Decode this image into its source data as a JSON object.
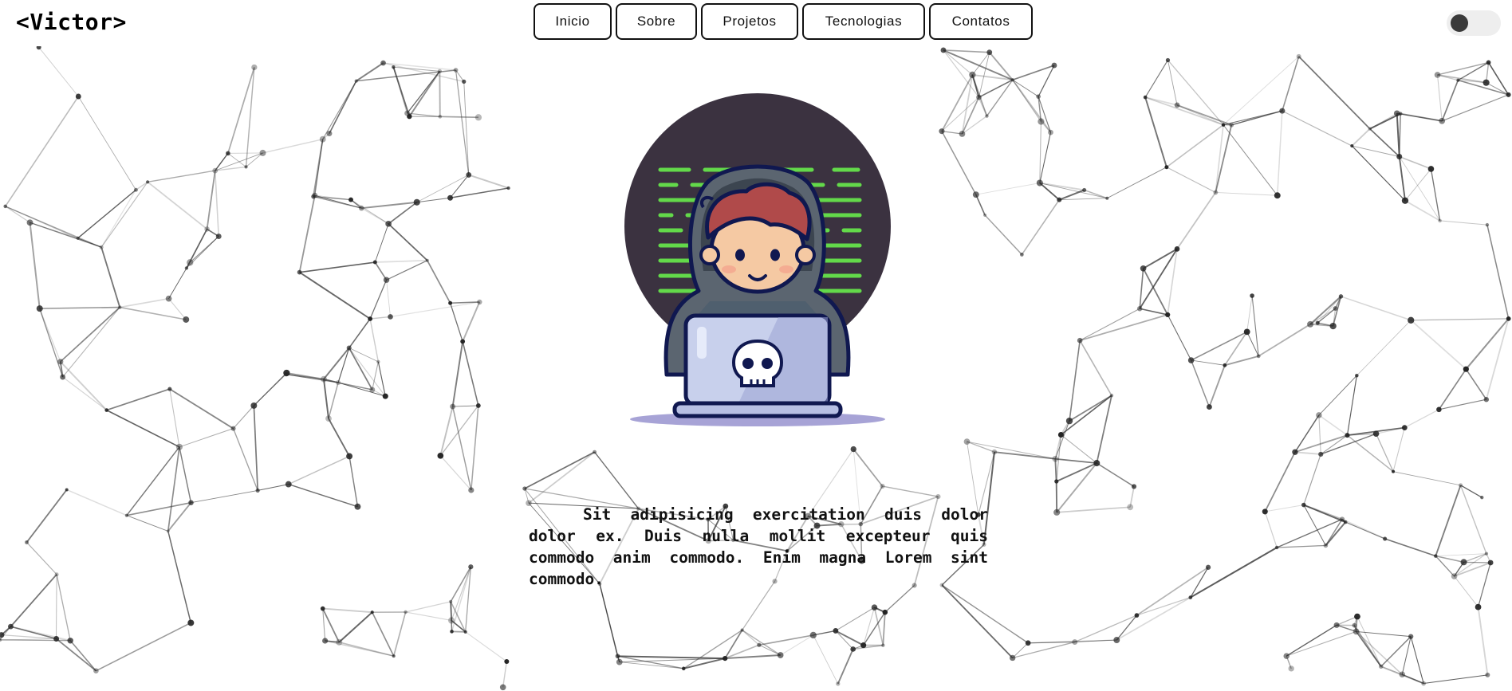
{
  "header": {
    "logo": "<Victor>",
    "nav": [
      {
        "label": "Inicio"
      },
      {
        "label": "Sobre"
      },
      {
        "label": "Projetos"
      },
      {
        "label": "Tecnologias"
      },
      {
        "label": "Contatos"
      }
    ],
    "theme_toggle": {
      "state": "off"
    }
  },
  "hero": {
    "illustration": "hacker-avatar-illustration",
    "bio": "Sit adipisicing exercitation duis dolor dolor ex. Duis nulla mollit excepteur quis commodo anim commodo. Enim magna Lorem sint commodo."
  },
  "colors": {
    "background": "#ffffff",
    "text": "#111111",
    "network_lines": "#555555",
    "avatar_circle": "#3b3240",
    "code_lines": "#63d94a",
    "hair": "#b04a4a",
    "hood": "#5b6570",
    "laptop": "#c8d0ec"
  }
}
